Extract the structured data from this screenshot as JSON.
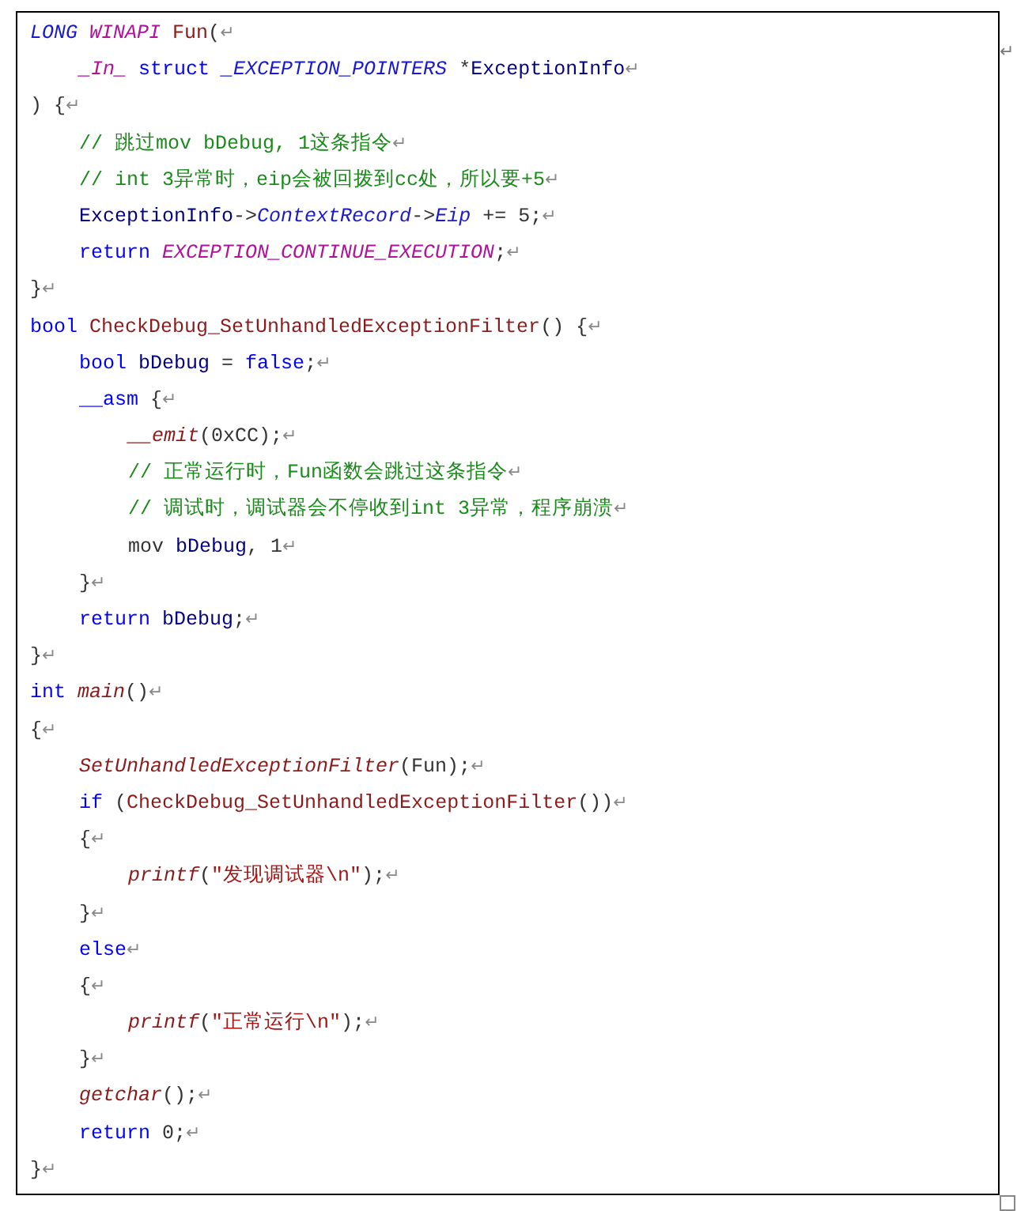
{
  "code_block": {
    "lines": [
      {
        "tokens": [
          {
            "kind": "type",
            "text": "LONG "
          },
          {
            "kind": "macro",
            "text": "WINAPI "
          },
          {
            "kind": "func",
            "text": "Fun"
          },
          {
            "kind": "plain",
            "text": "("
          },
          {
            "kind": "mark",
            "text": "↵"
          }
        ],
        "children": [
          {
            "tokens": [
              {
                "kind": "macro",
                "text": "_In_ "
              },
              {
                "kind": "keyword",
                "text": "struct "
              },
              {
                "kind": "type",
                "text": "_EXCEPTION_POINTERS"
              },
              {
                "kind": "plain",
                "text": " *"
              },
              {
                "kind": "ident",
                "text": "ExceptionInfo"
              },
              {
                "kind": "mark",
                "text": "↵"
              }
            ]
          }
        ]
      },
      {
        "tokens": [
          {
            "kind": "plain",
            "text": ") {"
          },
          {
            "kind": "mark",
            "text": "↵"
          }
        ],
        "children": [
          {
            "tokens": [
              {
                "kind": "comment",
                "text": "// 跳过mov bDebug, 1这条指令"
              },
              {
                "kind": "mark",
                "text": "↵"
              }
            ]
          },
          {
            "tokens": [
              {
                "kind": "comment",
                "text": "// int 3异常时，eip会被回拨到cc处，所以要+5"
              },
              {
                "kind": "mark",
                "text": "↵"
              }
            ]
          },
          {
            "tokens": [
              {
                "kind": "ident",
                "text": "ExceptionInfo"
              },
              {
                "kind": "plain",
                "text": "->"
              },
              {
                "kind": "type",
                "text": "ContextRecord"
              },
              {
                "kind": "plain",
                "text": "->"
              },
              {
                "kind": "type",
                "text": "Eip"
              },
              {
                "kind": "plain",
                "text": " += 5;"
              },
              {
                "kind": "mark",
                "text": "↵"
              }
            ]
          },
          {
            "tokens": [
              {
                "kind": "keyword",
                "text": "return "
              },
              {
                "kind": "macro",
                "text": "EXCEPTION_CONTINUE_EXECUTION"
              },
              {
                "kind": "plain",
                "text": ";"
              },
              {
                "kind": "mark",
                "text": "↵"
              }
            ]
          }
        ]
      },
      {
        "tokens": [
          {
            "kind": "plain",
            "text": "}"
          },
          {
            "kind": "mark",
            "text": "↵"
          }
        ]
      },
      {
        "tokens": [
          {
            "kind": "keyword",
            "text": "bool "
          },
          {
            "kind": "func",
            "text": "CheckDebug_SetUnhandledExceptionFilter"
          },
          {
            "kind": "plain",
            "text": "() {"
          },
          {
            "kind": "mark",
            "text": "↵"
          }
        ],
        "children": [
          {
            "tokens": [
              {
                "kind": "keyword",
                "text": "bool "
              },
              {
                "kind": "ident",
                "text": "bDebug"
              },
              {
                "kind": "plain",
                "text": " = "
              },
              {
                "kind": "keyword",
                "text": "false"
              },
              {
                "kind": "plain",
                "text": ";"
              },
              {
                "kind": "mark",
                "text": "↵"
              }
            ]
          },
          {
            "tokens": [
              {
                "kind": "keyword",
                "text": "__asm"
              },
              {
                "kind": "plain",
                "text": " {"
              },
              {
                "kind": "mark",
                "text": "↵"
              }
            ],
            "children": [
              {
                "tokens": [
                  {
                    "kind": "call",
                    "text": "__emit"
                  },
                  {
                    "kind": "plain",
                    "text": "(0xCC);"
                  },
                  {
                    "kind": "mark",
                    "text": "↵"
                  }
                ]
              },
              {
                "tokens": [
                  {
                    "kind": "comment",
                    "text": "// 正常运行时，Fun函数会跳过这条指令"
                  },
                  {
                    "kind": "mark",
                    "text": "↵"
                  }
                ]
              },
              {
                "tokens": [
                  {
                    "kind": "comment",
                    "text": "// 调试时，调试器会不停收到int 3异常，程序崩溃"
                  },
                  {
                    "kind": "mark",
                    "text": "↵"
                  }
                ]
              },
              {
                "tokens": [
                  {
                    "kind": "plain",
                    "text": "mov "
                  },
                  {
                    "kind": "ident",
                    "text": "bDebug"
                  },
                  {
                    "kind": "plain",
                    "text": ", 1"
                  },
                  {
                    "kind": "mark",
                    "text": "↵"
                  }
                ]
              }
            ]
          },
          {
            "tokens": [
              {
                "kind": "plain",
                "text": "}"
              },
              {
                "kind": "mark",
                "text": "↵"
              }
            ]
          },
          {
            "tokens": [
              {
                "kind": "keyword",
                "text": "return "
              },
              {
                "kind": "ident",
                "text": "bDebug"
              },
              {
                "kind": "plain",
                "text": ";"
              },
              {
                "kind": "mark",
                "text": "↵"
              }
            ]
          }
        ]
      },
      {
        "tokens": [
          {
            "kind": "plain",
            "text": "}"
          },
          {
            "kind": "mark",
            "text": "↵"
          }
        ]
      },
      {
        "tokens": [
          {
            "kind": "keyword",
            "text": "int "
          },
          {
            "kind": "call",
            "text": "main"
          },
          {
            "kind": "plain",
            "text": "()"
          },
          {
            "kind": "mark",
            "text": "↵"
          }
        ]
      },
      {
        "tokens": [
          {
            "kind": "plain",
            "text": "{"
          },
          {
            "kind": "mark",
            "text": "↵"
          }
        ],
        "children": [
          {
            "tokens": [
              {
                "kind": "call",
                "text": "SetUnhandledExceptionFilter"
              },
              {
                "kind": "plain",
                "text": "(Fun);"
              },
              {
                "kind": "mark",
                "text": "↵"
              }
            ]
          },
          {
            "tokens": [
              {
                "kind": "keyword",
                "text": "if"
              },
              {
                "kind": "plain",
                "text": " ("
              },
              {
                "kind": "func",
                "text": "CheckDebug_SetUnhandledExceptionFilter"
              },
              {
                "kind": "plain",
                "text": "())"
              },
              {
                "kind": "mark",
                "text": "↵"
              }
            ]
          },
          {
            "tokens": [
              {
                "kind": "plain",
                "text": "{"
              },
              {
                "kind": "mark",
                "text": "↵"
              }
            ],
            "children": [
              {
                "tokens": [
                  {
                    "kind": "call",
                    "text": "printf"
                  },
                  {
                    "kind": "plain",
                    "text": "("
                  },
                  {
                    "kind": "string",
                    "text": "\"发现调试器\\n\""
                  },
                  {
                    "kind": "plain",
                    "text": ");"
                  },
                  {
                    "kind": "mark",
                    "text": "↵"
                  }
                ]
              }
            ]
          },
          {
            "tokens": [
              {
                "kind": "plain",
                "text": "}"
              },
              {
                "kind": "mark",
                "text": "↵"
              }
            ]
          },
          {
            "tokens": [
              {
                "kind": "keyword",
                "text": "else"
              },
              {
                "kind": "mark",
                "text": "↵"
              }
            ]
          },
          {
            "tokens": [
              {
                "kind": "plain",
                "text": "{"
              },
              {
                "kind": "mark",
                "text": "↵"
              }
            ],
            "children": [
              {
                "tokens": [
                  {
                    "kind": "call",
                    "text": "printf"
                  },
                  {
                    "kind": "plain",
                    "text": "("
                  },
                  {
                    "kind": "string",
                    "text": "\"正常运行\\n\""
                  },
                  {
                    "kind": "plain",
                    "text": ");"
                  },
                  {
                    "kind": "mark",
                    "text": "↵"
                  }
                ]
              }
            ]
          },
          {
            "tokens": [
              {
                "kind": "plain",
                "text": "}"
              },
              {
                "kind": "mark",
                "text": "↵"
              }
            ]
          },
          {
            "tokens": [
              {
                "kind": "call",
                "text": "getchar"
              },
              {
                "kind": "plain",
                "text": "();"
              },
              {
                "kind": "mark",
                "text": "↵"
              }
            ]
          },
          {
            "tokens": [
              {
                "kind": "keyword",
                "text": "return"
              },
              {
                "kind": "plain",
                "text": " 0;"
              },
              {
                "kind": "mark",
                "text": "↵"
              }
            ]
          }
        ]
      },
      {
        "tokens": [
          {
            "kind": "plain",
            "text": "}"
          },
          {
            "kind": "mark",
            "text": "↵"
          }
        ]
      }
    ],
    "row_end_mark": "↵"
  }
}
